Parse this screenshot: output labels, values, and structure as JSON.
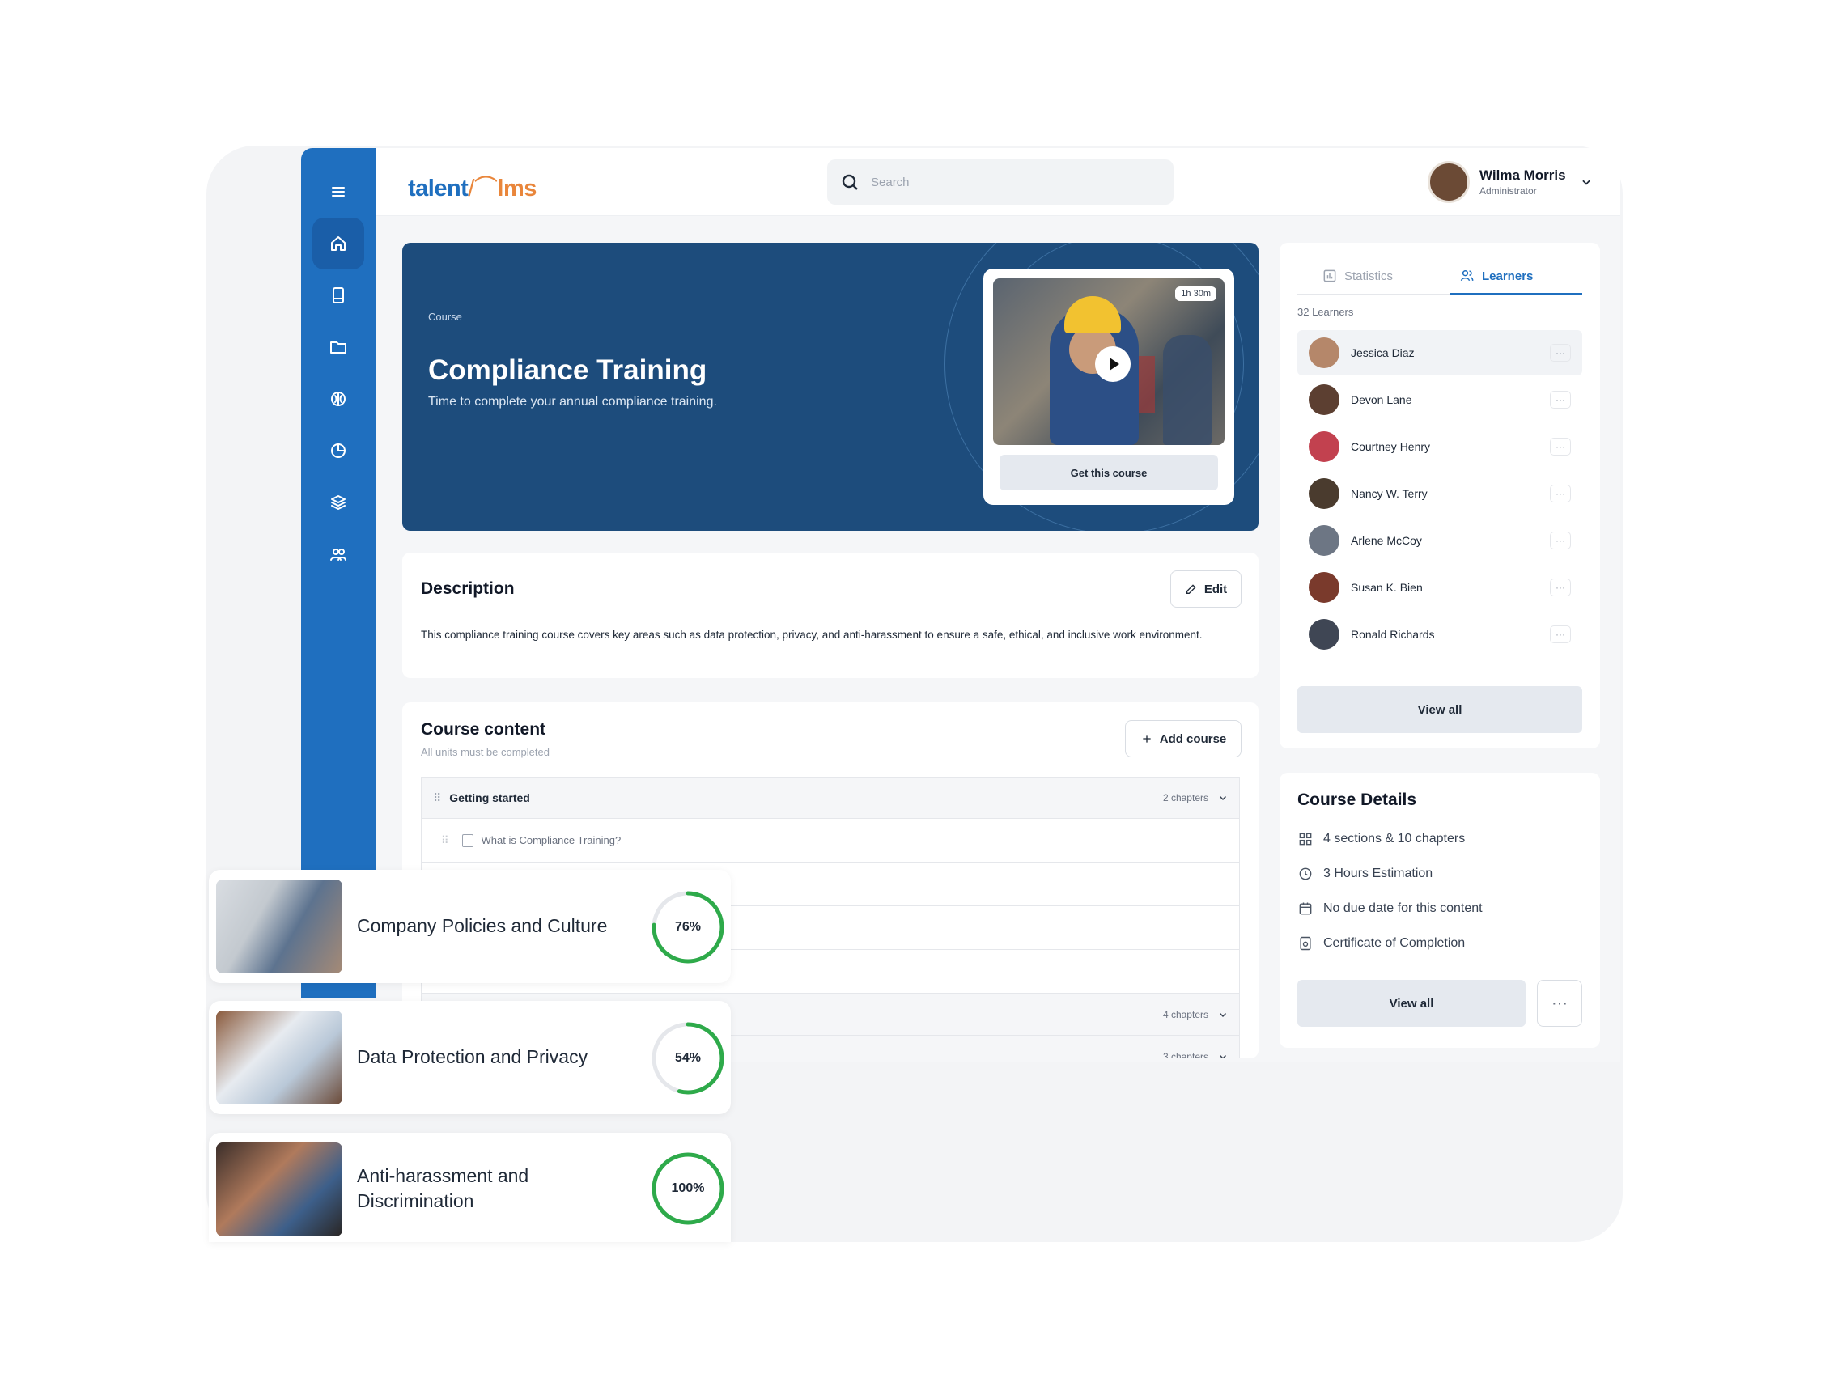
{
  "header": {
    "logo_left": "talent",
    "logo_right": "lms",
    "search_placeholder": "Search",
    "user_name": "Wilma Morris",
    "user_role": "Administrator"
  },
  "sidebar": {
    "icons": [
      "menu-icon",
      "home-icon",
      "book-icon",
      "folder-icon",
      "brain-icon",
      "pie-chart-icon",
      "layers-icon",
      "users-icon"
    ]
  },
  "hero": {
    "kicker": "Course",
    "title": "Compliance Training",
    "subtitle": "Time to complete your annual compliance training.",
    "duration": "1h 30m",
    "cta": "Get this course"
  },
  "description": {
    "title": "Description",
    "edit": "Edit",
    "text": "This compliance training course covers key areas such as data protection, privacy, and anti-harassment to ensure a safe, ethical, and inclusive work environment."
  },
  "course_content": {
    "title": "Course content",
    "note": "All units must be completed",
    "add": "Add course",
    "sections": [
      {
        "label": "Getting started",
        "count": "2 chapters"
      },
      {
        "label": "",
        "count": "4 chapters"
      },
      {
        "label": "",
        "count": "3 chapters"
      }
    ],
    "units": [
      "What is Compliance Training?"
    ]
  },
  "learners_panel": {
    "tab_statistics": "Statistics",
    "tab_learners": "Learners",
    "count": "32 Learners",
    "learners": [
      "Jessica Diaz",
      "Devon Lane",
      "Courtney Henry",
      "Nancy W. Terry",
      "Arlene McCoy",
      "Susan K. Bien",
      "Ronald Richards"
    ],
    "more": "···",
    "view_all": "View all"
  },
  "course_details": {
    "title": "Course Details",
    "items": [
      "4 sections & 10 chapters",
      "3 Hours Estimation",
      "No due date for this content",
      "Certificate of Completion"
    ],
    "view_all": "View all",
    "more": "···"
  },
  "floating_courses": [
    {
      "title": "Company Policies and Culture",
      "progress_label": "76%",
      "progress": 0.76
    },
    {
      "title": "Data Protection and Privacy",
      "progress_label": "54%",
      "progress": 0.54
    },
    {
      "title_line1": "Anti-harassment and",
      "title_line2": "Discrimination",
      "progress_label": "100%",
      "progress": 1.0
    }
  ],
  "colors": {
    "brand_blue": "#1f6fbf",
    "hero_navy": "#1d4c7c",
    "progress_green": "#2eaa4a",
    "logo_orange": "#e9863b"
  }
}
